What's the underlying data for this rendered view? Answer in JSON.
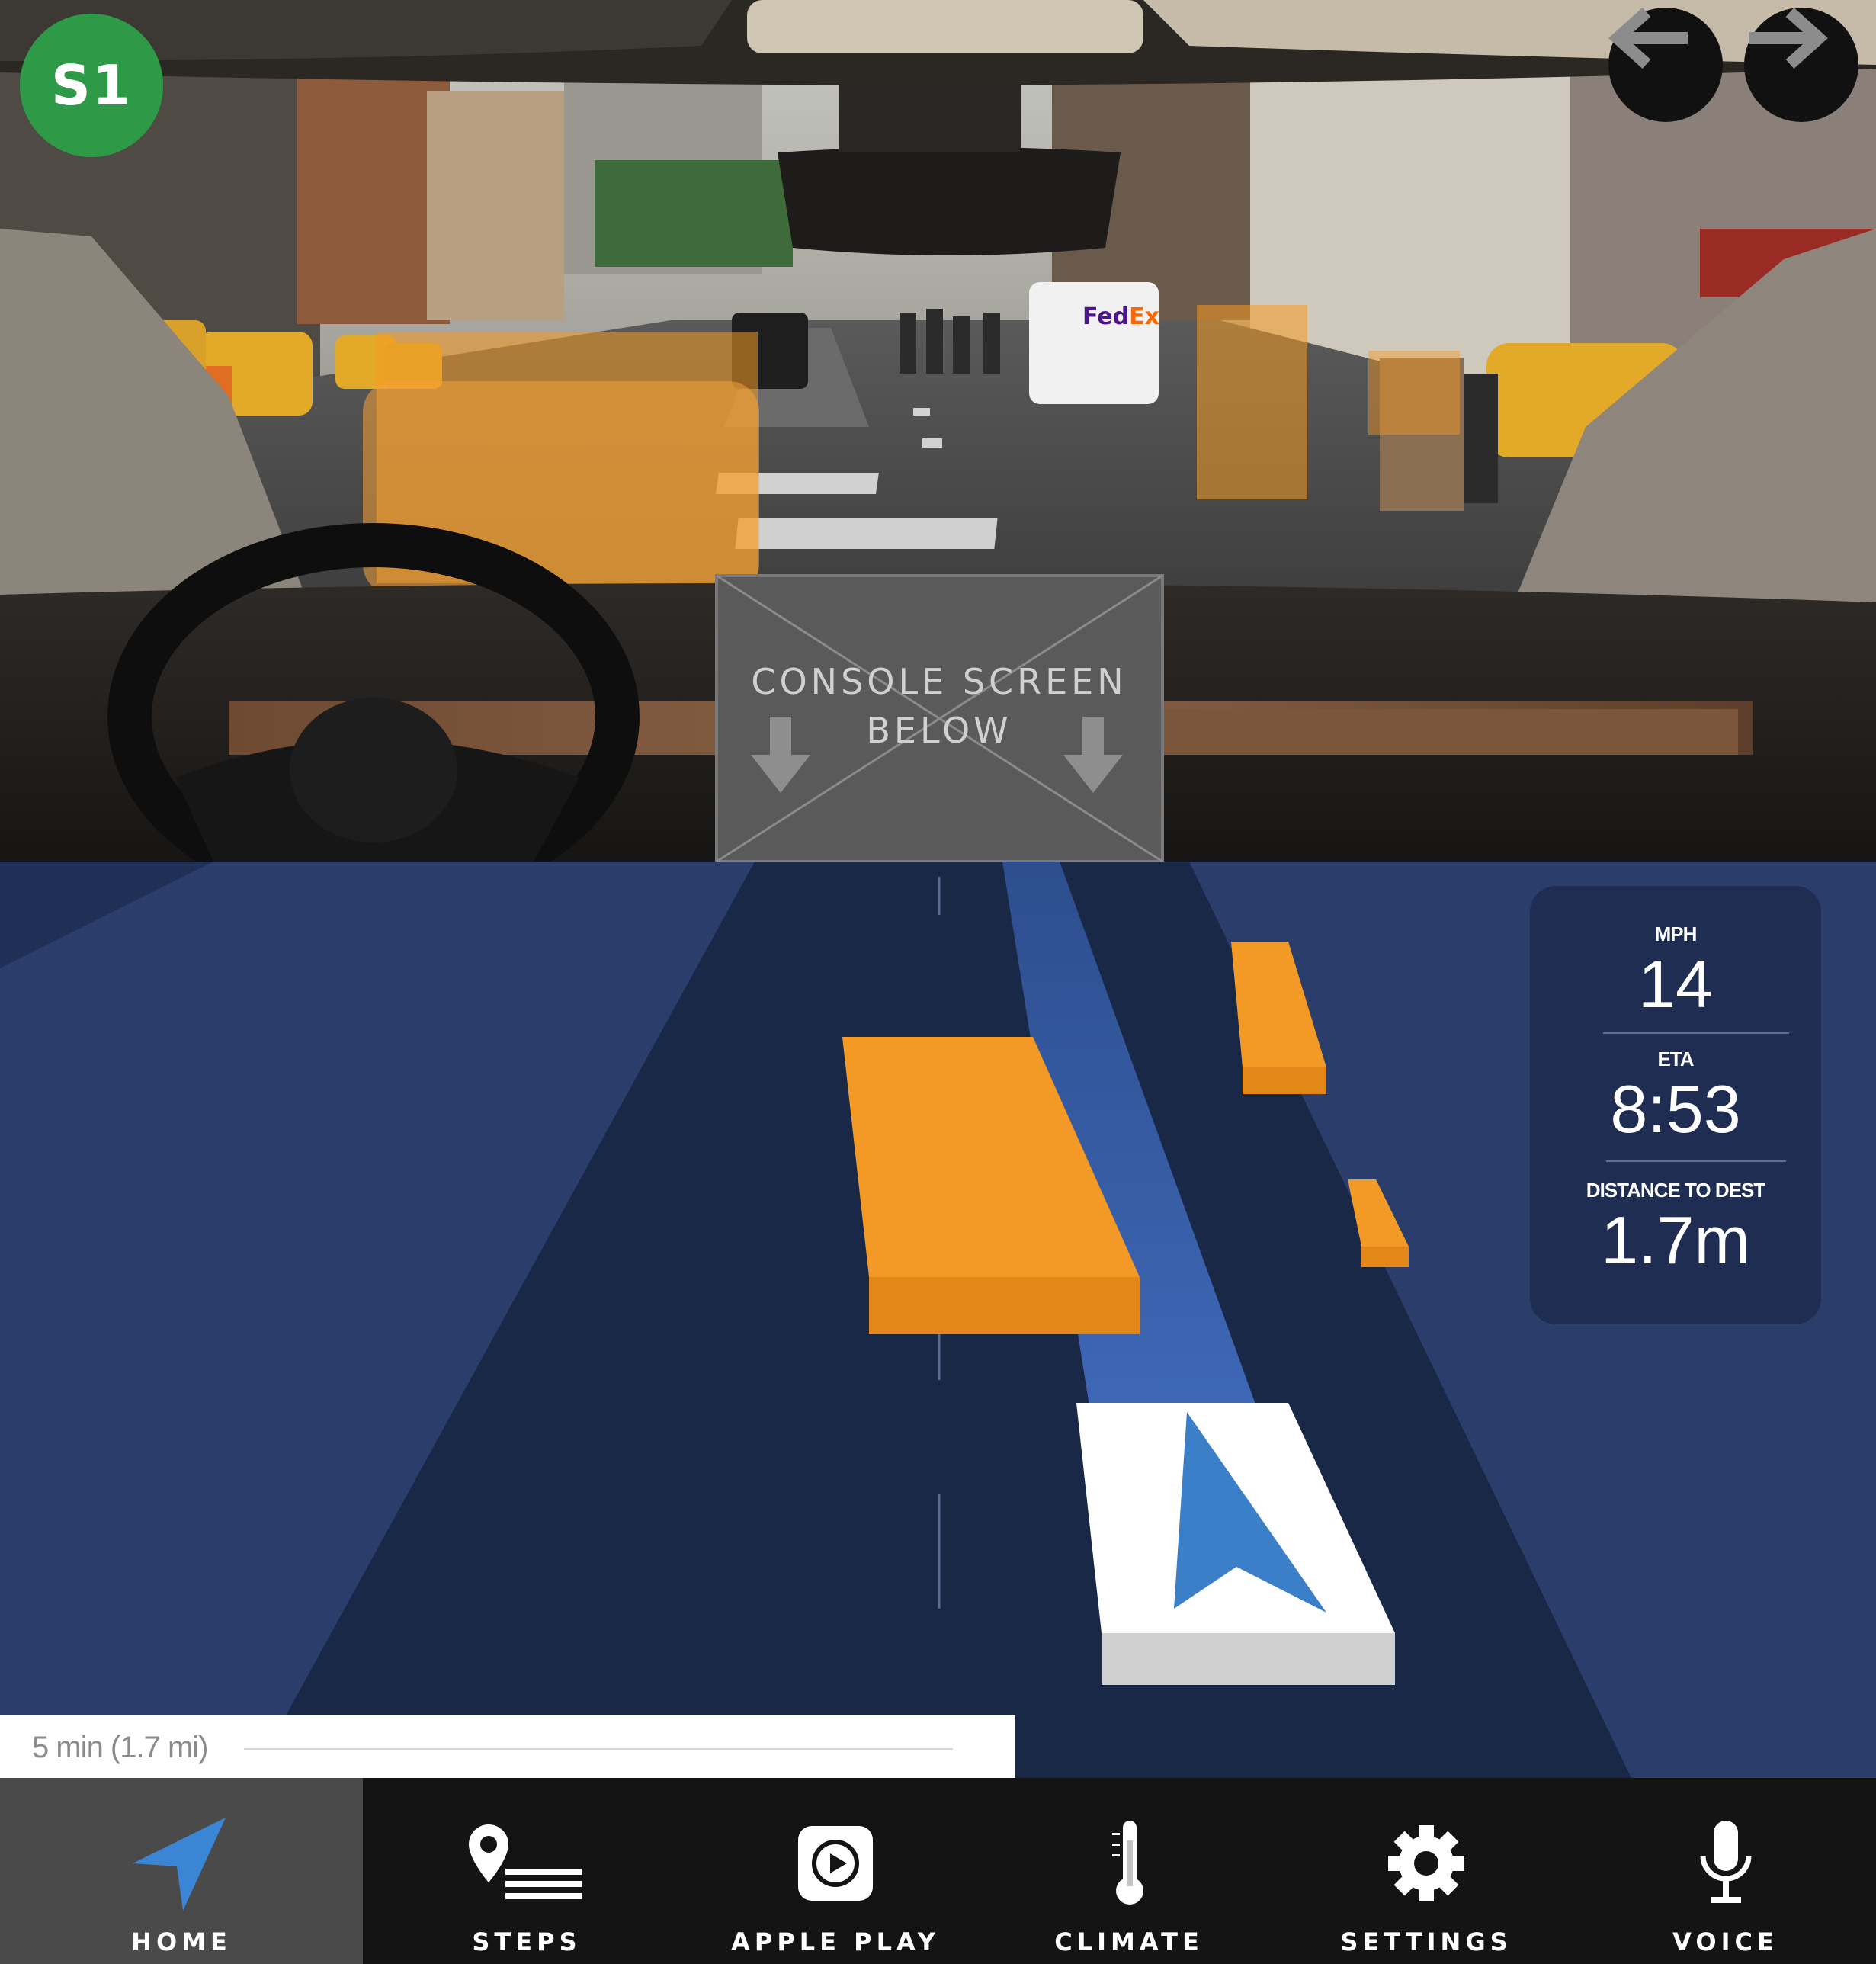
{
  "badge": {
    "label": "S1"
  },
  "nav_arrows": {
    "back_icon": "arrow-left-icon",
    "forward_icon": "arrow-right-icon"
  },
  "console_screen": {
    "label": "CONSOLE SCREEN\nBELOW"
  },
  "trip_info": {
    "speed_label": "MPH",
    "speed_value": "14",
    "eta_label": "ETA",
    "eta_value": "8:53",
    "distance_label": "DISTANCE TO DEST",
    "distance_value": "1.7m"
  },
  "route_summary": {
    "text": "5 min (1.7 mi)"
  },
  "bottom_nav": {
    "items": [
      {
        "label": "HOME",
        "icon": "navigation-arrow-icon",
        "active": true
      },
      {
        "label": "STEPS",
        "icon": "steps-list-icon"
      },
      {
        "label": "APPLE PLAY",
        "icon": "apple-play-icon"
      },
      {
        "label": "CLIMATE",
        "icon": "thermometer-icon"
      },
      {
        "label": "SETTINGS",
        "icon": "gear-icon"
      },
      {
        "label": "VOICE",
        "icon": "microphone-icon"
      }
    ]
  },
  "colors": {
    "badge": "#2e9a47",
    "detection_overlay": "#f59a23",
    "road_dark": "#1a2848",
    "road_light": "#2b3e6b",
    "lane_highlight": "#3a62a8",
    "ego_arrow": "#3a7fc8",
    "nav_bar": "#141414",
    "nav_active": "#4a4a4a"
  }
}
